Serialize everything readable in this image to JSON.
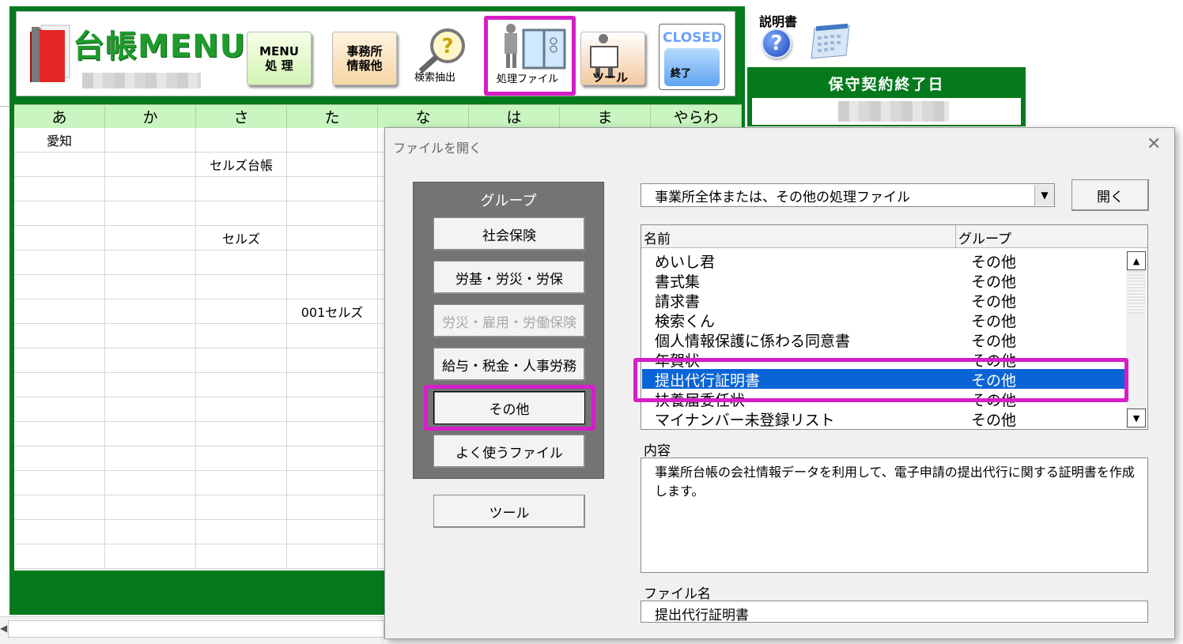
{
  "menu": {
    "title": "台帳MENU",
    "buttons": {
      "menu_line1": "MENU",
      "menu_line2": "処 理",
      "office_line1": "事務所",
      "office_line2": "情報他",
      "search": "検索抽出",
      "process_file": "処理ファイル",
      "tool": "ツール",
      "closed": "CLOSED",
      "exit": "終了"
    },
    "kana_headers": [
      "あ",
      "か",
      "さ",
      "た",
      "な",
      "は",
      "ま",
      "やらわ"
    ],
    "cells": {
      "r1c1": "愛知",
      "r2c3": "セルズ台帳",
      "r5c3": "セルズ",
      "r8c4": "001セルズ"
    }
  },
  "right_panel": {
    "manual_label": "説明書",
    "help_icon": "?",
    "contract_end_label": "保守契約終了日"
  },
  "dialog": {
    "title": "ファイルを開く",
    "close": "✕",
    "group_label": "グループ",
    "groups": [
      {
        "label": "社会保険",
        "state": "normal"
      },
      {
        "label": "労基・労災・労保",
        "state": "normal"
      },
      {
        "label": "労災・雇用・労働保険",
        "state": "disabled"
      },
      {
        "label": "給与・税金・人事労務",
        "state": "normal"
      },
      {
        "label": "その他",
        "state": "pressed"
      },
      {
        "label": "よく使うファイル",
        "state": "normal"
      }
    ],
    "tool_button": "ツール",
    "combo_value": "事業所全体または、その他の処理ファイル",
    "open_button": "開く",
    "list_headers": {
      "name": "名前",
      "group": "グループ"
    },
    "list_rows": [
      {
        "name": "めいし君",
        "group": "その他",
        "selected": false
      },
      {
        "name": "書式集",
        "group": "その他",
        "selected": false
      },
      {
        "name": "請求書",
        "group": "その他",
        "selected": false
      },
      {
        "name": "検索くん",
        "group": "その他",
        "selected": false
      },
      {
        "name": "個人情報保護に係わる同意書",
        "group": "その他",
        "selected": false
      },
      {
        "name": "年賀状",
        "group": "その他",
        "selected": false
      },
      {
        "name": "提出代行証明書",
        "group": "その他",
        "selected": true
      },
      {
        "name": "扶養届委任状",
        "group": "その他",
        "selected": false
      },
      {
        "name": "マイナンバー未登録リスト",
        "group": "その他",
        "selected": false
      }
    ],
    "content_label": "内容",
    "content_text": "事業所台帳の会社情報データを利用して、電子申請の提出代行に関する証明書を作成します。",
    "filename_label": "ファイル名",
    "filename_value": "提出代行証明書"
  },
  "colors": {
    "panel_green": "#057a1d",
    "highlight": "#d51ec8",
    "selection": "#0a64d6",
    "kana_header_bg": "#c8f5c0"
  }
}
